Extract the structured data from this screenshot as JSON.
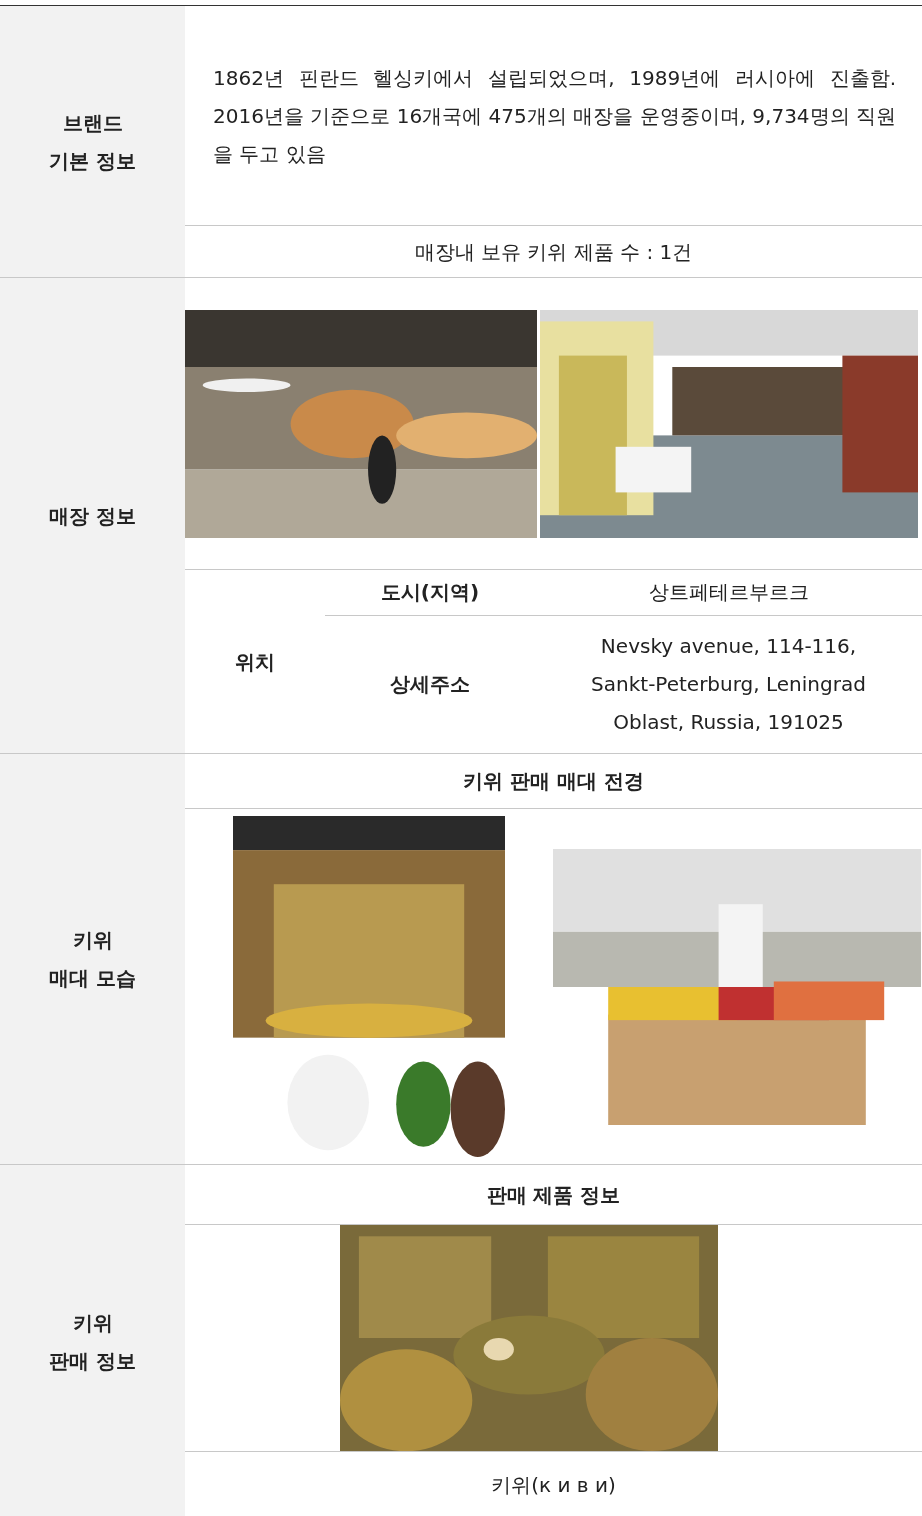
{
  "sections": [
    {
      "kind": "brand",
      "label_lines": [
        "브랜드",
        "기본 정보"
      ],
      "paragraph": "1862년 핀란드 헬싱키에서 설립되었으며, 1989년에 러시아에 진출함. 2016년을 기준으로 16개국에 475개의 매장을 운영중이며, 9,734명의 직원을 두고 있음",
      "count": "매장내 보유 키위 제품 수 : 1건"
    },
    {
      "kind": "store",
      "label_lines": [
        "매장 정보"
      ],
      "photos": [
        {
          "kind": "picture"
        },
        {
          "kind": "picture"
        }
      ],
      "location": {
        "label": "위치",
        "rows": [
          {
            "key": "도시(지역)",
            "value": "상트페테르부르크"
          },
          {
            "key": "상세주소",
            "value": "Nevsky avenue, 114-116, Sankt-Peterburg, Leningrad Oblast, Russia, 191025"
          }
        ]
      }
    },
    {
      "kind": "display",
      "label_lines": [
        "키위",
        "매대 모습"
      ],
      "header": "키위 판매 매대 전경",
      "photos": [
        {
          "kind": "picture"
        },
        {
          "kind": "picture"
        }
      ]
    },
    {
      "kind": "product",
      "label_lines": [
        "키위",
        "판매 정보"
      ],
      "header": "판매 제품 정보",
      "photos": [
        {
          "kind": "picture"
        }
      ],
      "caption": "키위(к и в и)"
    }
  ]
}
